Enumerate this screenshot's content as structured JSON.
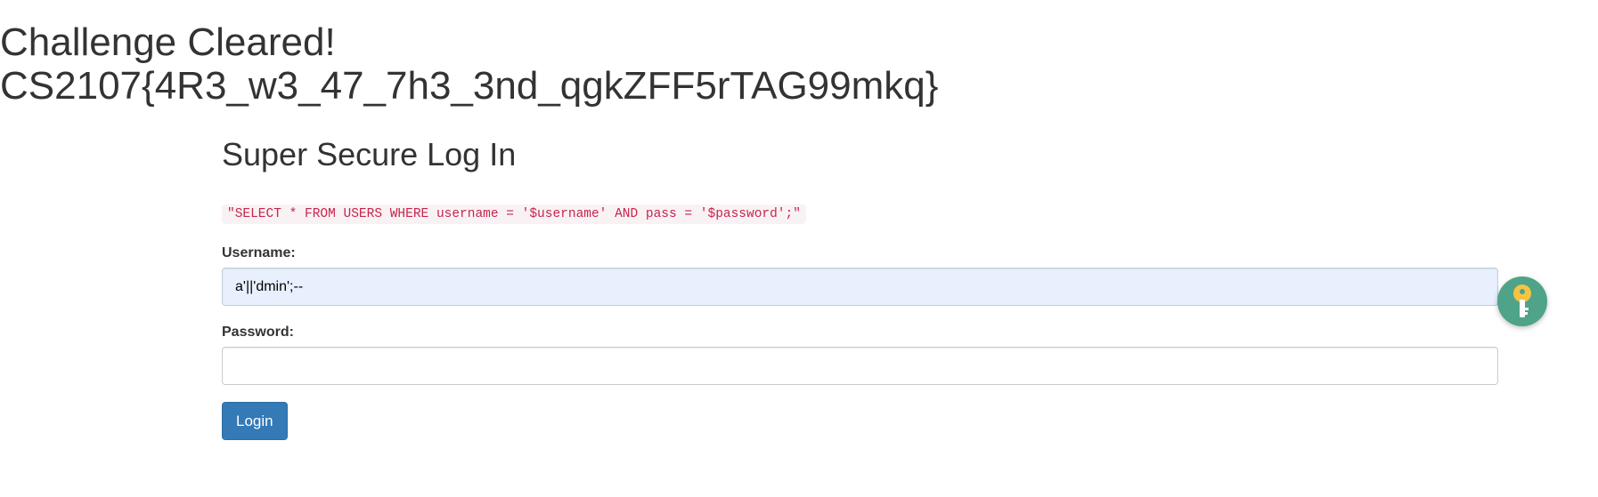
{
  "banner": {
    "title": "Challenge Cleared!",
    "flag": "CS2107{4R3_w3_47_7h3_3nd_qgkZFF5rTAG99mkq}"
  },
  "form": {
    "title": "Super Secure Log In",
    "query": "\"SELECT * FROM USERS WHERE username = '$username' AND pass = '$password';\"",
    "username_label": "Username:",
    "username_value": "a'||'dmin';--",
    "password_label": "Password:",
    "password_value": "",
    "login_label": "Login"
  },
  "password_manager": {
    "icon": "key-icon",
    "color": "#4ea389"
  },
  "colors": {
    "primary_button": "#337ab7",
    "code_text": "#c7254e",
    "code_background": "#f9f2f4",
    "autofill_background": "#e8f0fe"
  }
}
